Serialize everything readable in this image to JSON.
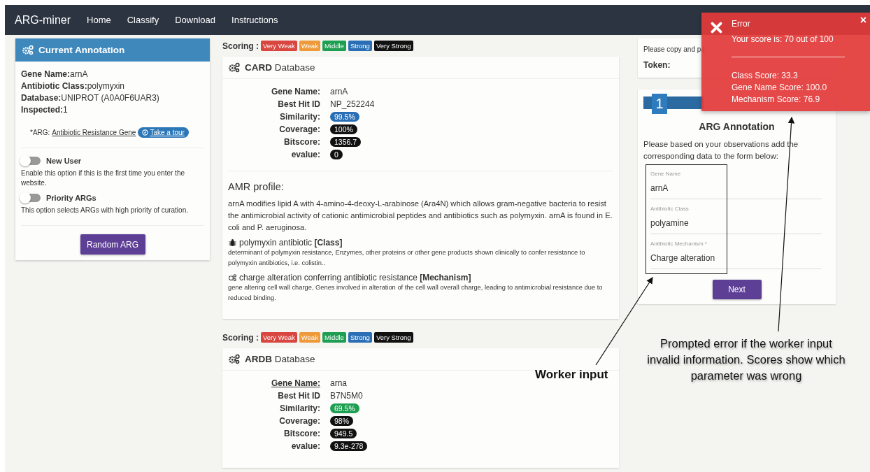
{
  "nav": {
    "brand": "ARG-miner",
    "links": [
      "Home",
      "Classify",
      "Download",
      "Instructions"
    ]
  },
  "current_annotation": {
    "title": "Current Annotation",
    "fields": [
      {
        "label": "Gene Name:",
        "value": "arnA"
      },
      {
        "label": "Antibiotic Class:",
        "value": "polymyxin"
      },
      {
        "label": "Database:",
        "value": "UNIPROT (A0A0F6UAR3)"
      },
      {
        "label": "Inspected:",
        "value": "1"
      }
    ],
    "note_prefix": "*ARG:",
    "note_link": "Antibiotic Resistance Gene",
    "tour_button": "Take a tour",
    "toggles": [
      {
        "label": "New User",
        "on": false,
        "description": "Enable this option if this is the first time you enter the website."
      },
      {
        "label": "Priority ARGs",
        "on": false,
        "description": "This option selects ARGs with high priority of curation."
      }
    ],
    "button": "Random ARG"
  },
  "databases": [
    {
      "scoring_label": "Scoring :",
      "scoring_levels": [
        {
          "label": "Very Weak",
          "color": "#d9463f"
        },
        {
          "label": "Weak",
          "color": "#ee9a3a"
        },
        {
          "label": "Middle",
          "color": "#1e9e50"
        },
        {
          "label": "Strong",
          "color": "#2a6fb5"
        },
        {
          "label": "Very Strong",
          "color": "#111111"
        }
      ],
      "title": "**CARD** Database",
      "rows": [
        {
          "label": "Gene Name:",
          "value": "arnA",
          "kind": "text",
          "underlined": false
        },
        {
          "label": "Best Hit ID",
          "value": "NP_252244",
          "kind": "text",
          "underlined": false
        },
        {
          "label": "Similarity:",
          "value": "99.5%",
          "kind": "badge",
          "color": "#2a6fb5",
          "underlined": false
        },
        {
          "label": "Coverage:",
          "value": "100%",
          "kind": "badge",
          "color": "#111111",
          "underlined": false
        },
        {
          "label": "Bitscore:",
          "value": "1356.7",
          "kind": "badge",
          "color": "#111111",
          "underlined": false
        },
        {
          "label": "evalue:",
          "value": "0",
          "kind": "badge",
          "color": "#111111",
          "underlined": false
        }
      ],
      "amr_profile": {
        "title": "AMR profile:",
        "text": "arnA modifies lipid A with 4-amino-4-deoxy-L-arabinose (Ara4N) which allows gram-negative bacteria to resist the antimicrobial activity of cationic antimicrobial peptides and antibiotics such as polymyxin. arnA is found in E. coli and P. aeruginosa.",
        "entries": [
          {
            "kind": "bug",
            "heading": "polymyxin antibiotic **[Class]**",
            "description": "determinant of polymyxin resistance, Enzymes, other proteins or other gene products shown clinically to confer resistance to polymyxin antibiotics, i.e. colistin.."
          },
          {
            "kind": "gears",
            "heading": "charge alteration conferring antibiotic resistance **[Mechanism]**",
            "description": "gene altering cell wall charge, Genes involved in alteration of the cell wall overall charge, leading to antimicrobial resistance due to reduced binding."
          }
        ]
      }
    },
    {
      "scoring_label": "Scoring :",
      "scoring_levels": [
        {
          "label": "Very Weak",
          "color": "#d9463f"
        },
        {
          "label": "Weak",
          "color": "#ee9a3a"
        },
        {
          "label": "Middle",
          "color": "#1e9e50"
        },
        {
          "label": "Strong",
          "color": "#2a6fb5"
        },
        {
          "label": "Very Strong",
          "color": "#111111"
        }
      ],
      "title": "**ARDB** Database",
      "rows": [
        {
          "label": "Gene Name:",
          "value": "arna",
          "kind": "text",
          "underlined": true
        },
        {
          "label": "Best Hit ID",
          "value": "B7N5M0",
          "kind": "text",
          "underlined": false
        },
        {
          "label": "Similarity:",
          "value": "69.5%",
          "kind": "badge",
          "color": "#1e9e50",
          "underlined": false
        },
        {
          "label": "Coverage:",
          "value": "98%",
          "kind": "badge",
          "color": "#111111",
          "underlined": false
        },
        {
          "label": "Bitscore:",
          "value": "949.5",
          "kind": "badge",
          "color": "#111111",
          "underlined": false
        },
        {
          "label": "evalue:",
          "value": "9.3e-278",
          "kind": "badge",
          "color": "#111111",
          "underlined": false
        }
      ]
    }
  ],
  "token_card": {
    "text": "Please copy and pa",
    "label": "Token:"
  },
  "annotation_form": {
    "step": "1",
    "title": "ARG Annotation",
    "instructions": "Please based on your observations add the corresponding data to the form below:",
    "fields": [
      {
        "label": "Gene Name",
        "value": "arnA"
      },
      {
        "label": "Antibiotic Class",
        "value": "polyamine"
      },
      {
        "label": "Antibiotic Mechanism *",
        "value": "Charge alteration"
      }
    ],
    "button": "Next"
  },
  "error_popup": {
    "title": "Error",
    "close": "×",
    "message": "Your score is: 70 out of 100",
    "scores": [
      "Class Score: 33.3",
      "Gene Name Score: 100.0",
      "Mechanism Score: 76.9"
    ]
  },
  "callouts": [
    {
      "text": "Worker input"
    },
    {
      "text": "Prompted error if the worker input invalid information. Scores show which parameter was wrong"
    }
  ]
}
